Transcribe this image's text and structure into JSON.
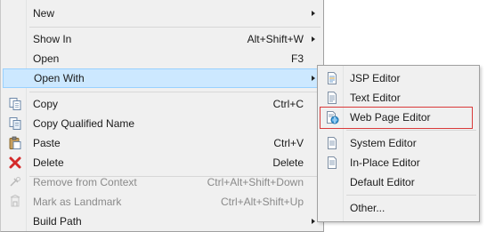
{
  "main_menu": {
    "items": [
      {
        "id": "new",
        "label": "New",
        "shortcut": "",
        "submenu": true,
        "icon": "",
        "disabled": false
      },
      {
        "id": "show-in",
        "label": "Show In",
        "shortcut": "Alt+Shift+W",
        "submenu": true,
        "icon": "",
        "disabled": false
      },
      {
        "id": "open",
        "label": "Open",
        "shortcut": "F3",
        "submenu": false,
        "icon": "",
        "disabled": false
      },
      {
        "id": "open-with",
        "label": "Open With",
        "shortcut": "",
        "submenu": true,
        "icon": "",
        "disabled": false
      },
      {
        "id": "copy",
        "label": "Copy",
        "shortcut": "Ctrl+C",
        "submenu": false,
        "icon": "copy-icon",
        "disabled": false
      },
      {
        "id": "copy-qualified-name",
        "label": "Copy Qualified Name",
        "shortcut": "",
        "submenu": false,
        "icon": "copy-qualified-name-icon",
        "disabled": false
      },
      {
        "id": "paste",
        "label": "Paste",
        "shortcut": "Ctrl+V",
        "submenu": false,
        "icon": "paste-icon",
        "disabled": false
      },
      {
        "id": "delete",
        "label": "Delete",
        "shortcut": "Delete",
        "submenu": false,
        "icon": "delete-icon",
        "disabled": false
      },
      {
        "id": "remove-from-context",
        "label": "Remove from Context",
        "shortcut": "Ctrl+Alt+Shift+Down",
        "submenu": false,
        "icon": "remove-context-icon",
        "disabled": true
      },
      {
        "id": "mark-as-landmark",
        "label": "Mark as Landmark",
        "shortcut": "Ctrl+Alt+Shift+Up",
        "submenu": false,
        "icon": "landmark-icon",
        "disabled": true
      },
      {
        "id": "build-path",
        "label": "Build Path",
        "shortcut": "",
        "submenu": true,
        "icon": "",
        "disabled": false
      }
    ],
    "highlighted": "open-with"
  },
  "open_with_submenu": {
    "items": [
      {
        "id": "jsp-editor",
        "label": "JSP Editor",
        "icon": "jsp-file-icon"
      },
      {
        "id": "text-editor",
        "label": "Text Editor",
        "icon": "text-file-icon"
      },
      {
        "id": "web-page-editor",
        "label": "Web Page Editor",
        "icon": "web-page-editor-icon"
      },
      {
        "id": "system-editor",
        "label": "System Editor",
        "icon": "system-editor-icon"
      },
      {
        "id": "in-place-editor",
        "label": "In-Place Editor",
        "icon": "in-place-editor-icon"
      },
      {
        "id": "default-editor",
        "label": "Default Editor",
        "icon": ""
      },
      {
        "id": "other",
        "label": "Other...",
        "icon": ""
      }
    ],
    "outlined": "web-page-editor"
  },
  "colors": {
    "menu_bg": "#f0f0f0",
    "highlight_bg": "#cce8ff",
    "highlight_border": "#99d1ff",
    "annotation_outline": "#d93a3a",
    "disabled_text": "#8a8a8a"
  }
}
